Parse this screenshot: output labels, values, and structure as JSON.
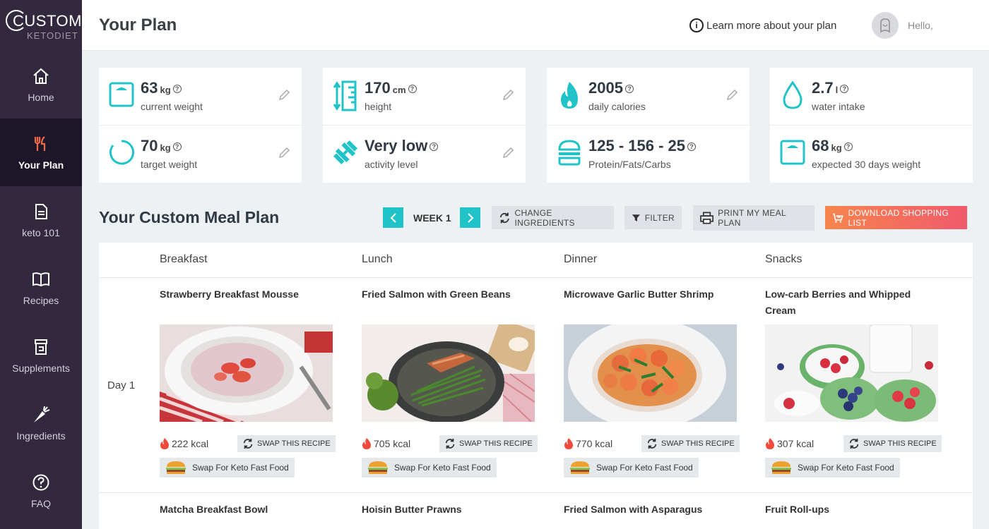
{
  "logo": {
    "line1": "CUSTOM",
    "line2": "KETODIET"
  },
  "sidebar": {
    "items": [
      {
        "label": "Home",
        "icon": "home-icon"
      },
      {
        "label": "Your Plan",
        "icon": "utensils-icon",
        "active": true
      },
      {
        "label": "keto 101",
        "icon": "document-icon"
      },
      {
        "label": "Recipes",
        "icon": "book-icon"
      },
      {
        "label": "Supplements",
        "icon": "jar-icon"
      },
      {
        "label": "Ingredients",
        "icon": "carrot-icon"
      },
      {
        "label": "FAQ",
        "icon": "question-icon"
      }
    ]
  },
  "header": {
    "title": "Your Plan",
    "learn_more": "Learn more about your plan",
    "hello": "Hello,"
  },
  "stats": [
    {
      "value": "63",
      "unit": "kg",
      "label": "current weight",
      "icon": "scale-icon"
    },
    {
      "value": "70",
      "unit": "kg",
      "label": "target weight",
      "icon": "target-ring-icon"
    },
    {
      "value": "170",
      "unit": "cm",
      "label": "height",
      "icon": "ruler-icon"
    },
    {
      "value": "Very low",
      "unit": "",
      "label": "activity level",
      "icon": "dumbbell-icon"
    },
    {
      "value": "2005",
      "unit": "",
      "label": "daily calories",
      "icon": "flame-icon"
    },
    {
      "value": "125 - 156 - 25",
      "unit": "",
      "label": "Protein/Fats/Carbs",
      "icon": "burger-icon"
    },
    {
      "value": "2.7",
      "unit": "l",
      "label": "water intake",
      "icon": "drop-icon"
    },
    {
      "value": "68",
      "unit": "kg",
      "label": "expected 30 days weight",
      "icon": "scale-icon"
    }
  ],
  "meal_plan": {
    "title": "Your Custom Meal Plan",
    "week_label": "WEEK 1",
    "change_ingredients": "CHANGE INGREDIENTS",
    "filter": "FILTER",
    "print": "PRINT MY MEAL PLAN",
    "download": "DOWNLOAD SHOPPING LIST",
    "columns": [
      "Breakfast",
      "Lunch",
      "Dinner",
      "Snacks"
    ],
    "day1": {
      "label": "Day 1",
      "meals": [
        {
          "name": "Strawberry Breakfast Mousse",
          "kcal": "222 kcal"
        },
        {
          "name": "Fried Salmon with Green Beans",
          "kcal": "705 kcal"
        },
        {
          "name": "Microwave Garlic Butter Shrimp",
          "kcal": "770 kcal"
        },
        {
          "name": "Low-carb Berries and Whipped Cream",
          "kcal": "307 kcal"
        }
      ]
    },
    "swap_label": "SWAP THIS RECIPE",
    "fast_food_label": "Swap For Keto Fast Food",
    "day2_meals": [
      "Matcha Breakfast Bowl",
      "Hoisin Butter Prawns",
      "Fried Salmon with Asparagus",
      "Fruit Roll-ups"
    ]
  },
  "colors": {
    "sidebar": "#33293f",
    "sidebar_active": "#1d1628",
    "accent": "#20c4c8",
    "download_start": "#f7854d",
    "download_end": "#f05a6c"
  }
}
